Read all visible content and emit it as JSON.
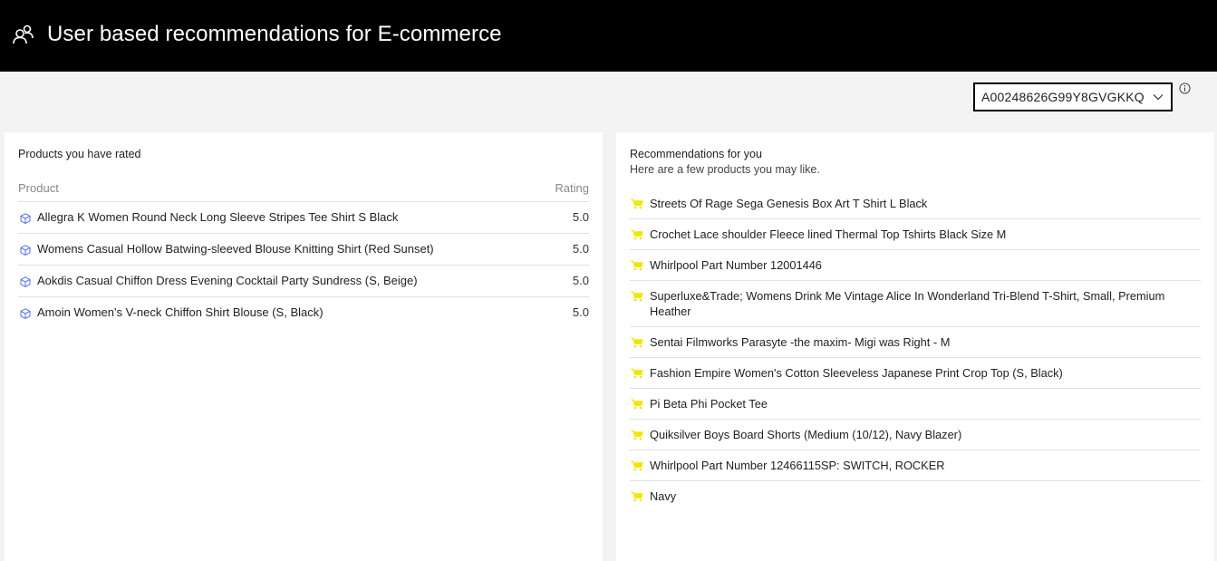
{
  "header": {
    "title": "User based recommendations for E-commerce",
    "icon": "users-icon"
  },
  "user_select": {
    "value": "A00248626G99Y8GVGKKQ",
    "icon": "chevron-down-icon"
  },
  "info_icon": "info-icon",
  "rated": {
    "heading": "Products you have rated",
    "columns": {
      "product": "Product",
      "rating": "Rating"
    },
    "rows": [
      {
        "name": "Allegra K Women Round Neck Long Sleeve Stripes Tee Shirt S Black",
        "rating": "5.0"
      },
      {
        "name": "Womens Casual Hollow Batwing-sleeved Blouse Knitting Shirt (Red Sunset)",
        "rating": "5.0"
      },
      {
        "name": "Aokdis Casual Chiffon Dress Evening Cocktail Party Sundress (S, Beige)",
        "rating": "5.0"
      },
      {
        "name": "Amoin Women's V-neck Chiffon Shirt Blouse (S, Black)",
        "rating": "5.0"
      }
    ],
    "row_icon": "product-cube-icon",
    "icon_color": "#5b6ee1"
  },
  "recommendations": {
    "heading": "Recommendations for you",
    "subheading": "Here are a few products you may like.",
    "item_icon": "shopping-cart-icon",
    "icon_color": "#f2e600",
    "items": [
      "Streets Of Rage Sega Genesis Box Art T Shirt L Black",
      "Crochet Lace shoulder Fleece lined Thermal Top Tshirts Black Size M",
      "Whirlpool Part Number 12001446",
      "Superluxe&Trade; Womens Drink Me Vintage Alice In Wonderland Tri-Blend T-Shirt, Small, Premium Heather",
      "Sentai Filmworks Parasyte -the maxim- Migi was Right - M",
      "Fashion Empire Women's Cotton Sleeveless Japanese Print Crop Top (S, Black)",
      "Pi Beta Phi Pocket Tee",
      "Quiksilver Boys Board Shorts (Medium (10/12), Navy Blazer)",
      "Whirlpool Part Number 12466115SP: SWITCH, ROCKER",
      "Navy"
    ]
  }
}
